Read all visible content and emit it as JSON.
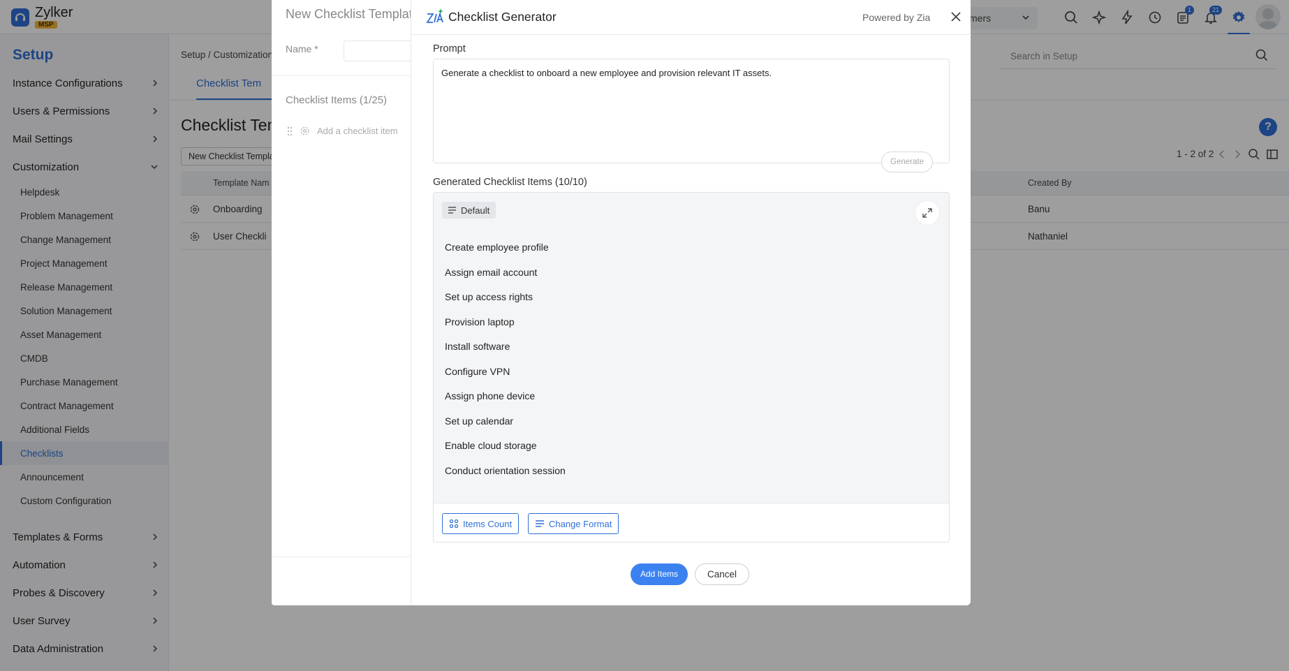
{
  "app": {
    "name": "Zylker",
    "badge": "MSP",
    "account_select": "mers",
    "notifications": {
      "tasks_count": "1",
      "bell_count": "21"
    }
  },
  "sidebar": {
    "title": "Setup",
    "groups_top": [
      {
        "label": "Instance Configurations"
      },
      {
        "label": "Users & Permissions"
      },
      {
        "label": "Mail Settings"
      },
      {
        "label": "Customization"
      }
    ],
    "customization_items": [
      "Helpdesk",
      "Problem Management",
      "Change Management",
      "Project Management",
      "Release Management",
      "Solution Management",
      "Asset Management",
      "CMDB",
      "Purchase Management",
      "Contract Management",
      "Additional Fields",
      "Checklists",
      "Announcement",
      "Custom Configuration"
    ],
    "active_item": "Checklists",
    "groups_bottom": [
      {
        "label": "Templates & Forms"
      },
      {
        "label": "Automation"
      },
      {
        "label": "Probes & Discovery"
      },
      {
        "label": "User Survey"
      },
      {
        "label": "Data Administration"
      }
    ]
  },
  "main": {
    "breadcrumb": "Setup / Customization",
    "search_placeholder": "Search in Setup",
    "tab_active": "Checklist Tem",
    "page_title": "Checklist Tem",
    "help": "?",
    "new_template_button": "New Checklist Template",
    "pager": "1 - 2 of 2",
    "table": {
      "headers": {
        "name": "Template Nam",
        "created_by": "Created By"
      },
      "rows": [
        {
          "name": "Onboarding",
          "created_by": "Banu"
        },
        {
          "name": "User Checkli",
          "created_by": "Nathaniel"
        }
      ]
    }
  },
  "template_dialog": {
    "title": "New Checklist Template",
    "name_label": "Name *",
    "items_title": "Checklist Items (1/25)",
    "add_placeholder": "Add a checklist item"
  },
  "generator": {
    "title": "Checklist Generator",
    "powered_by": "Powered by Zia",
    "prompt_label": "Prompt",
    "prompt_text": "Generate a checklist to onboard a new employee and provision relevant IT assets.",
    "generate_button": "Generate",
    "generated_label": "Generated Checklist Items (10/10)",
    "format_chip": "Default",
    "items": [
      "Create employee profile",
      "Assign email account",
      "Set up access rights",
      "Provision laptop",
      "Install software",
      "Configure VPN",
      "Assign phone device",
      "Set up calendar",
      "Enable cloud storage",
      "Conduct orientation session"
    ],
    "items_count_button": "Items Count",
    "change_format_button": "Change Format",
    "add_items_button": "Add Items",
    "cancel_button": "Cancel"
  },
  "colors": {
    "accent": "#2f6fd6",
    "primary_button": "#3b82f0",
    "overlay": "rgba(0,0,0,0.38)"
  }
}
